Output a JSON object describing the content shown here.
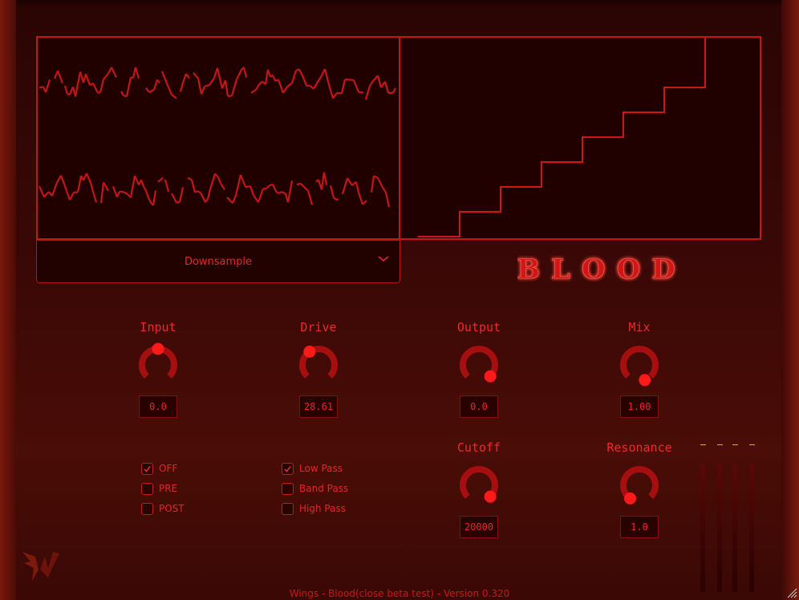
{
  "plugin": {
    "title": "BLOOD",
    "footer": "Wings - Blood(close beta test) - Version 0.320"
  },
  "mode": {
    "selected": "Downsample",
    "icon": "chevron-down-icon"
  },
  "knobs": {
    "input": {
      "label": "Input",
      "value": "0.0"
    },
    "drive": {
      "label": "Drive",
      "value": "28.61"
    },
    "output": {
      "label": "Output",
      "value": "0.0"
    },
    "mix": {
      "label": "Mix",
      "value": "1.00"
    },
    "cutoff": {
      "label": "Cutoff",
      "value": "20000"
    },
    "resonance": {
      "label": "Resonance",
      "value": "1.0"
    }
  },
  "filter_position": [
    {
      "label": "OFF",
      "checked": true
    },
    {
      "label": "PRE",
      "checked": false
    },
    {
      "label": "POST",
      "checked": false
    }
  ],
  "filter_type": [
    {
      "label": "Low Pass",
      "checked": true
    },
    {
      "label": "Band Pass",
      "checked": false
    },
    {
      "label": "High Pass",
      "checked": false
    }
  ],
  "colors": {
    "accent": "#ff1a1a",
    "panel_border": "#c81414",
    "panel_bg": "#200100",
    "text": "#e42828",
    "meter_cap": "#e8a060"
  },
  "staircase_steps": 8
}
